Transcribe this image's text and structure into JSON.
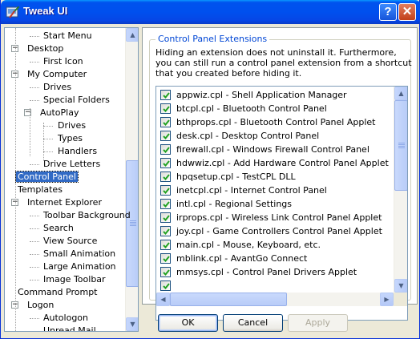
{
  "window": {
    "title": "Tweak UI",
    "help_glyph": "?",
    "close_glyph": "✕"
  },
  "tree": {
    "items": [
      {
        "label": "Start Menu",
        "level": 2,
        "expander": ""
      },
      {
        "label": "Desktop",
        "level": 0,
        "expander": "−"
      },
      {
        "label": "First Icon",
        "level": 2,
        "expander": ""
      },
      {
        "label": "My Computer",
        "level": 0,
        "expander": "−"
      },
      {
        "label": "Drives",
        "level": 2,
        "expander": ""
      },
      {
        "label": "Special Folders",
        "level": 2,
        "expander": ""
      },
      {
        "label": "AutoPlay",
        "level": 1,
        "expander": "−"
      },
      {
        "label": "Drives",
        "level": 3,
        "expander": ""
      },
      {
        "label": "Types",
        "level": 3,
        "expander": ""
      },
      {
        "label": "Handlers",
        "level": 3,
        "expander": ""
      },
      {
        "label": "Drive Letters",
        "level": 2,
        "expander": ""
      },
      {
        "label": "Control Panel",
        "level": 0.6,
        "expander": "",
        "selected": true
      },
      {
        "label": "Templates",
        "level": 0.6,
        "expander": ""
      },
      {
        "label": "Internet Explorer",
        "level": 0,
        "expander": "−"
      },
      {
        "label": "Toolbar Background",
        "level": 2,
        "expander": ""
      },
      {
        "label": "Search",
        "level": 2,
        "expander": ""
      },
      {
        "label": "View Source",
        "level": 2,
        "expander": ""
      },
      {
        "label": "Small Animation",
        "level": 2,
        "expander": ""
      },
      {
        "label": "Large Animation",
        "level": 2,
        "expander": ""
      },
      {
        "label": "Image Toolbar",
        "level": 2,
        "expander": ""
      },
      {
        "label": "Command Prompt",
        "level": 0.6,
        "expander": ""
      },
      {
        "label": "Logon",
        "level": 0,
        "expander": "−"
      },
      {
        "label": "Autologon",
        "level": 2,
        "expander": ""
      },
      {
        "label": "Unread Mail",
        "level": 2,
        "expander": ""
      }
    ]
  },
  "panel": {
    "group_title": "Control Panel Extensions",
    "description": "Hiding an extension does not uninstall it. Furthermore, you can still run a control panel extension from a shortcut that you created before hiding it.",
    "extensions": [
      {
        "label": "appwiz.cpl - Shell Application Manager",
        "checked": true
      },
      {
        "label": "btcpl.cpl - Bluetooth Control Panel",
        "checked": true
      },
      {
        "label": "bthprops.cpl - Bluetooth Control Panel Applet",
        "checked": true
      },
      {
        "label": "desk.cpl - Desktop Control Panel",
        "checked": true
      },
      {
        "label": "firewall.cpl - Windows Firewall Control Panel",
        "checked": true
      },
      {
        "label": "hdwwiz.cpl - Add Hardware Control Panel Applet",
        "checked": true
      },
      {
        "label": "hpqsetup.cpl - TestCPL DLL",
        "checked": true
      },
      {
        "label": "inetcpl.cpl - Internet Control Panel",
        "checked": true
      },
      {
        "label": "intl.cpl - Regional Settings",
        "checked": true
      },
      {
        "label": "irprops.cpl - Wireless Link Control Panel Applet",
        "checked": true
      },
      {
        "label": "joy.cpl - Game Controllers Control Panel Applet",
        "checked": true
      },
      {
        "label": "main.cpl - Mouse, Keyboard, etc.",
        "checked": true
      },
      {
        "label": "mblink.cpl - AvantGo Connect",
        "checked": true
      },
      {
        "label": "mmsys.cpl - Control Panel Drivers Applet",
        "checked": true
      },
      {
        "label": "",
        "checked": true
      }
    ]
  },
  "buttons": {
    "ok": "OK",
    "cancel": "Cancel",
    "apply": "Apply"
  }
}
